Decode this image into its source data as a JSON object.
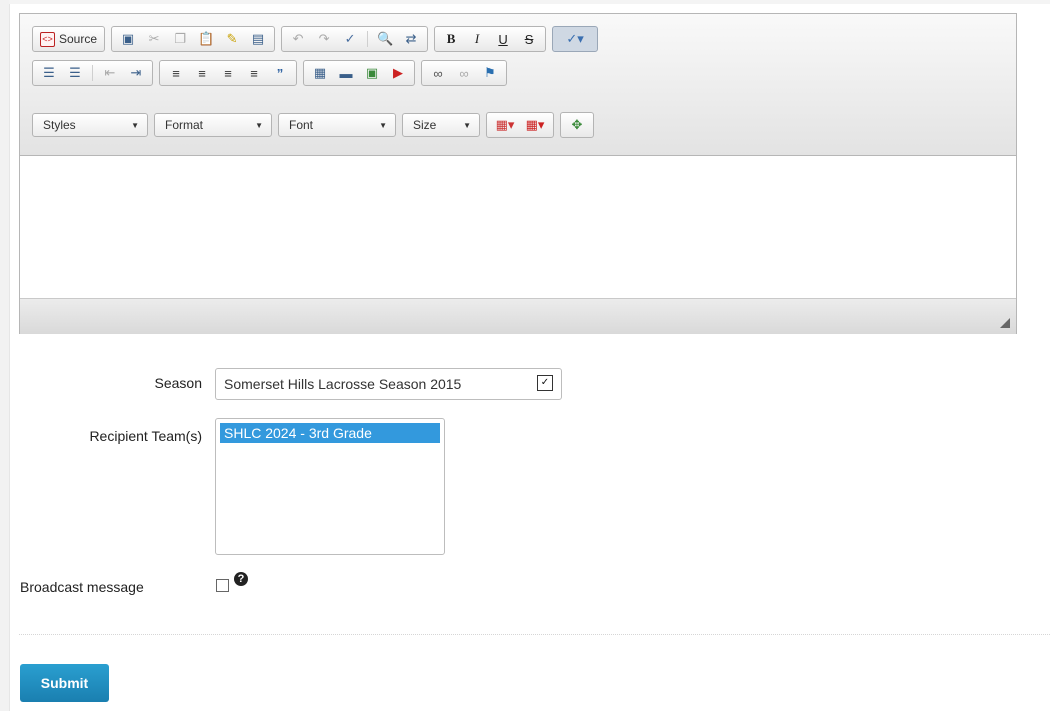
{
  "editor": {
    "source_label": "Source",
    "row1_icons": [
      "select-all-icon",
      "cut-icon",
      "copy-icon",
      "paste-icon",
      "paste-text-icon",
      "paste-word-icon",
      "undo-icon",
      "redo-icon",
      "spellcheck-icon",
      "find-icon",
      "replace-icon",
      "bold-icon",
      "italic-icon",
      "underline-icon",
      "strike-icon",
      "scayt-icon"
    ],
    "row3": {
      "styles": "Styles",
      "format": "Format",
      "font": "Font",
      "size": "Size"
    }
  },
  "form": {
    "season_label": "Season",
    "season_value": "Somerset Hills Lacrosse Season 2015",
    "recipient_label": "Recipient Team(s)",
    "recipient_options": [
      "SHLC 2024 - 3rd Grade"
    ],
    "broadcast_label": "Broadcast message",
    "help_glyph": "?",
    "submit_label": "Submit"
  }
}
